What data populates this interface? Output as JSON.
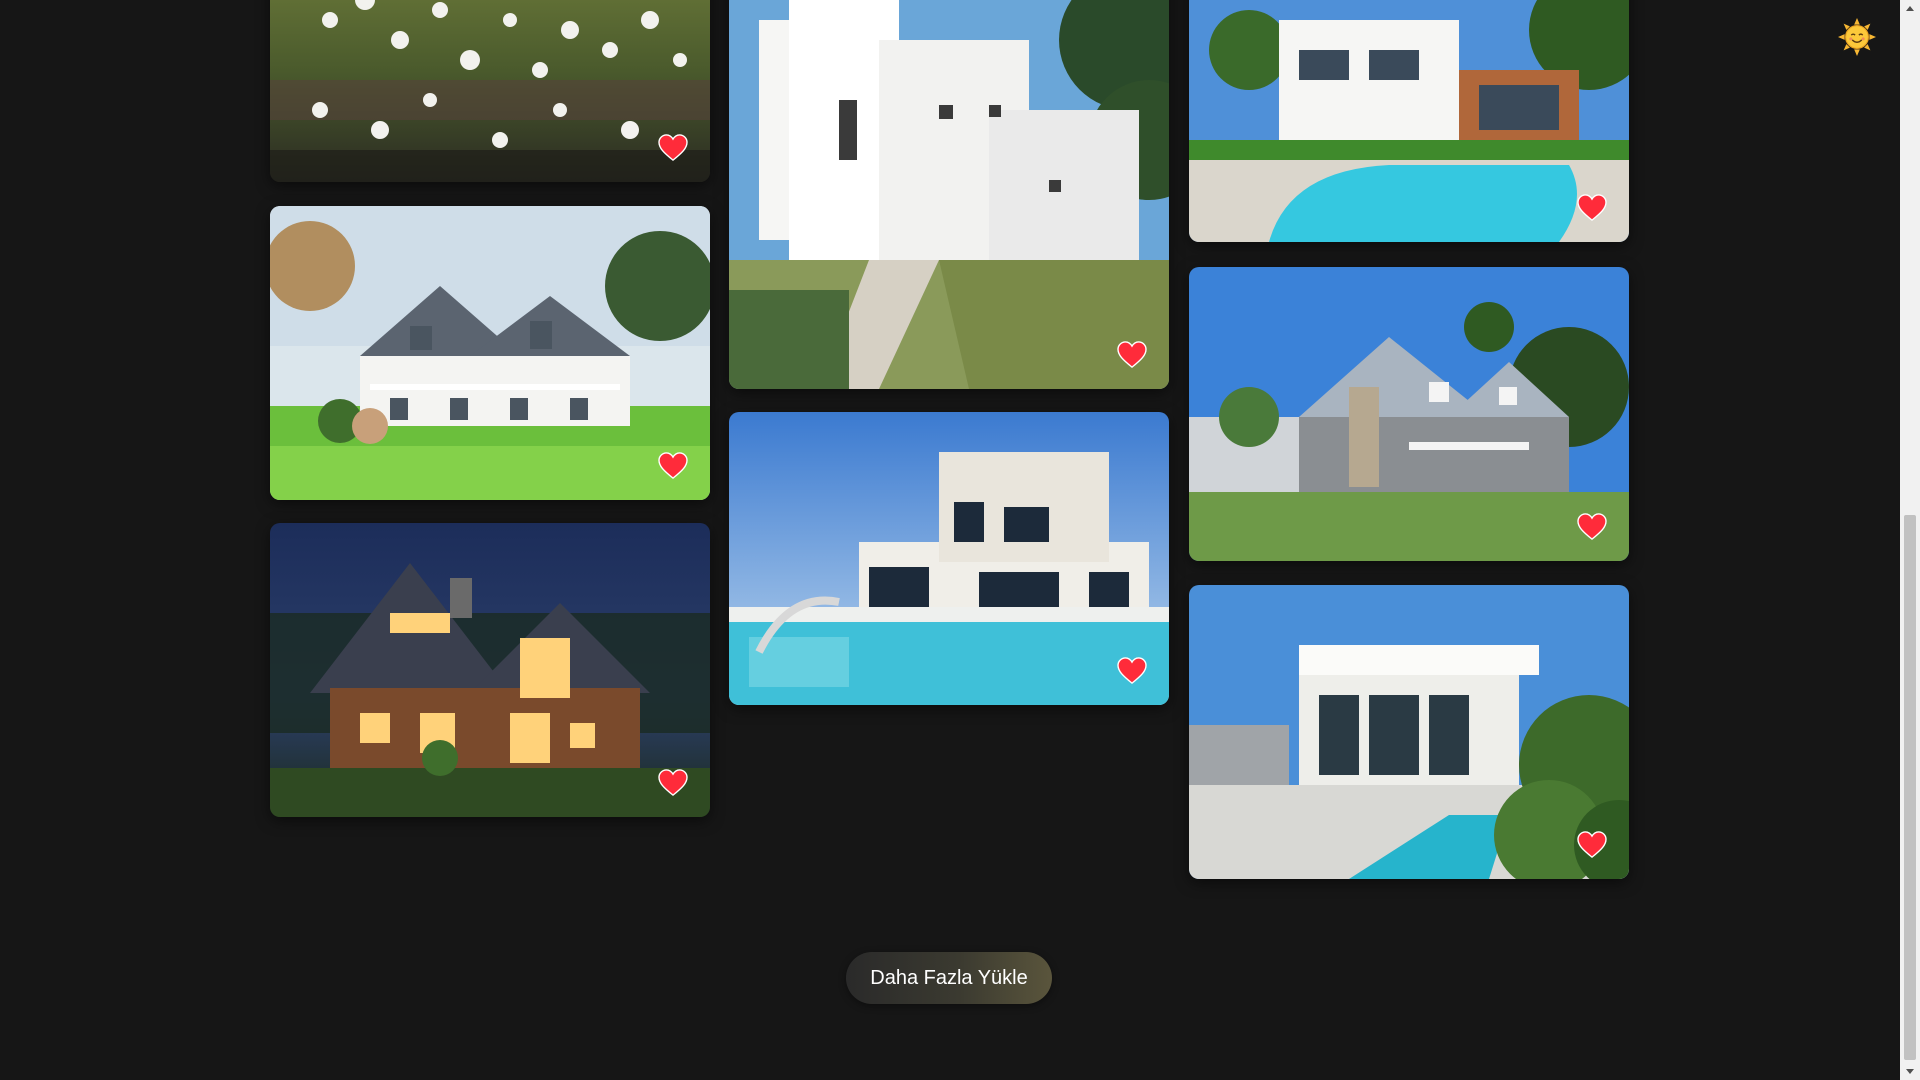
{
  "gallery": {
    "cards": [
      {
        "column": 1,
        "scene": "white-flowers-field",
        "favorite": true
      },
      {
        "column": 1,
        "scene": "white-farmhouse-porch",
        "favorite": true
      },
      {
        "column": 1,
        "scene": "wooden-house-dusk",
        "favorite": true
      },
      {
        "column": 2,
        "scene": "white-cubic-villa",
        "favorite": true
      },
      {
        "column": 2,
        "scene": "modern-villa-pool",
        "favorite": true
      },
      {
        "column": 3,
        "scene": "colonial-house-pool",
        "favorite": true
      },
      {
        "column": 3,
        "scene": "gray-house-palms",
        "favorite": true
      },
      {
        "column": 3,
        "scene": "modern-house-courtyard-pool",
        "favorite": true
      }
    ]
  },
  "load_more": {
    "label": "Daha Fazla Yükle"
  },
  "theme_toggle": {
    "icon": "sun-icon"
  },
  "colors": {
    "background": "#161616",
    "heart": "#ff2b3a",
    "sun": "#f7b733",
    "button_text": "#ffffff"
  }
}
